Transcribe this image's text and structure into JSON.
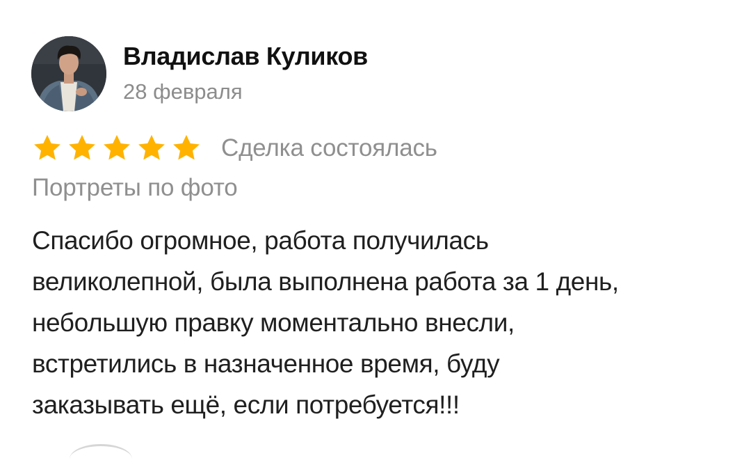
{
  "review": {
    "author": {
      "name": "Владислав Куликов",
      "avatar_icon": "person-photo-avatar"
    },
    "date": "28 февраля",
    "rating": {
      "stars": 5,
      "max_stars": 5,
      "star_color": "#ffb300",
      "star_icon": "star-icon"
    },
    "deal_status": "Сделка состоялась",
    "service": "Портреты по фото",
    "text_lines": [
      "Спасибо огромное, работа получилась",
      "великолепной, была выполнена работа за 1 день,",
      "небольшую правку моментально внесли,",
      "встретились в назначенное время, буду",
      "заказывать ещё, если потребуется!!!"
    ]
  },
  "colors": {
    "name": "#111111",
    "secondary_text": "#8f8f8f",
    "body_text": "#1f1f1f",
    "background": "#ffffff"
  }
}
